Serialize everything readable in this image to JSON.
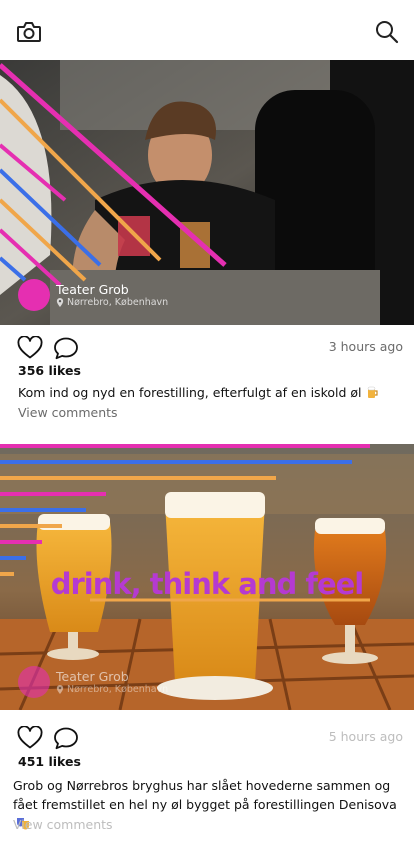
{
  "posts": [
    {
      "author": "Teater Grob",
      "location": "Nørrebro, København",
      "time": "3 hours ago",
      "likes": "356 likes",
      "caption": "Kom ind og nyd en forestilling, efterfulgt af en iskold øl",
      "view_comments": "View comments"
    },
    {
      "author": "Teater Grob",
      "location": "Nørrebro, København",
      "overlay_text": "drink, think and feel",
      "time": "5 hours ago",
      "likes": "451 likes",
      "caption": "Grob og Nørrebros bryghus har slået hovederne sammen og fået fremstillet en hel ny øl bygget på forestillingen Denisova",
      "view_comments": "View comments"
    }
  ],
  "icons": {
    "camera": "camera-icon",
    "search": "search-icon",
    "like": "heart-icon",
    "comment": "comment-icon",
    "location": "location-pin-icon"
  },
  "colors": {
    "accent": "#e52fb1",
    "stripe_blue": "#3b6fe8",
    "stripe_orange": "#f0a64a"
  }
}
